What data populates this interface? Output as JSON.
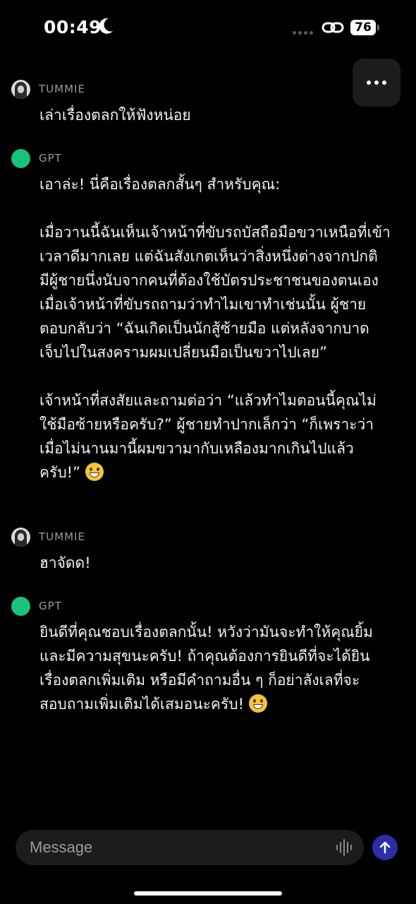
{
  "status_bar": {
    "time": "00:49",
    "battery": "76"
  },
  "messages": [
    {
      "sender": "TUMMIE",
      "paragraphs": [
        "เล่าเรื่องตลกให้ฟังหน่อย"
      ]
    },
    {
      "sender": "GPT",
      "paragraphs": [
        "เอาล่ะ! นี่คือเรื่องตลกสั้นๆ สำหรับคุณ:",
        "เมื่อวานนี้ฉันเห็นเจ้าหน้าที่ขับรถบัสถือมือขวาเหนือที่เข้าเวลาดีมากเลย แต่ฉันสังเกตเห็นว่าสิ่งหนึ่งต่างจากปกติ มีผู้ชายนึ่งนับจากคนที่ต้องใช้บัตรประชาชนของตนเอง เมื่อเจ้าหน้าที่ขับรถถามว่าทำไมเขาทำเช่นนั้น ผู้ชายตอบกลับว่า “ฉันเกิดเป็นนักสู้ซ้ายมือ แต่หลังจากบาดเจ็บไปในสงครามผมเปลี่ยนมือเป็นขวาไปเลย”",
        "เจ้าหน้าที่สงสัยและถามต่อว่า “แล้วทำไมตอนนี้คุณไม่ใช้มือซ้ายหรือครับ?” ผู้ชายทำปากเล็กว่า “ก็เพราะว่าเมื่อไม่นานมานี้ผมขวามากับเหลืองมากเกินไปแล้วครับ!”"
      ]
    },
    {
      "sender": "TUMMIE",
      "paragraphs": [
        "ฮาจัดด!"
      ]
    },
    {
      "sender": "GPT",
      "paragraphs": [
        "ยินดีที่คุณชอบเรื่องตลกนั้น! หวังว่ามันจะทำให้คุณยิ้มและมีความสุขนะครับ! ถ้าคุณต้องการยินดีที่จะได้ยินเรื่องตลกเพิ่มเติม หรือมีคำถามอื่น ๆ ก็อย่าลังเลที่จะสอบถามเพิ่มเติมได้เสมอนะครับ!"
      ]
    }
  ],
  "composer": {
    "placeholder": "Message"
  },
  "colors": {
    "background": "#000000",
    "gpt_avatar": "#19c37d",
    "send_button": "#2a2fa8",
    "input_bg": "#1c1c1e"
  }
}
